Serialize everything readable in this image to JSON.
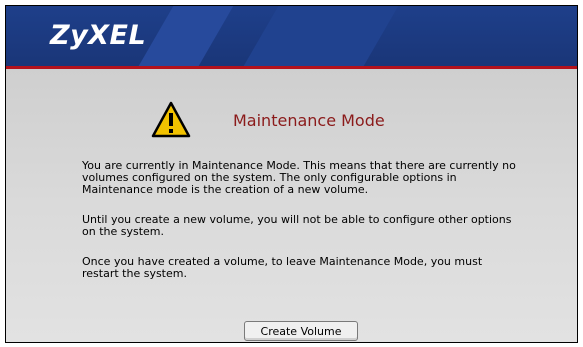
{
  "header": {
    "logo_text": "ZyXEL",
    "accent_color": "#b3121c",
    "background_color": "#1e3f8a"
  },
  "notice": {
    "icon": "warning-icon",
    "title": "Maintenance Mode",
    "paragraphs": [
      "You are currently in Maintenance Mode. This means that there are currently no volumes configured on the system. The only configurable options in Maintenance mode is the creation of a new volume.",
      "Until you create a new volume, you will not be able to configure other options on the system.",
      "Once you have created a volume, to leave Maintenance Mode, you must restart the system."
    ],
    "title_color": "#8b1a1a"
  },
  "actions": {
    "create_volume_label": "Create Volume"
  }
}
